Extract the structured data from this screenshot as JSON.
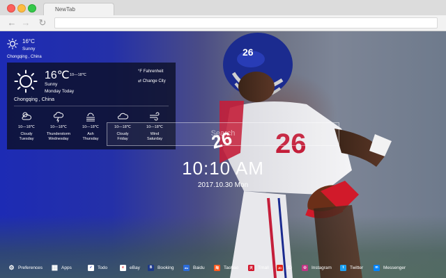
{
  "browser": {
    "tab_title": "NewTab",
    "nav": {
      "back": "←",
      "forward": "→",
      "reload": "↻"
    }
  },
  "weather_mini": {
    "temp": "16°C",
    "condition": "Sunny",
    "location": "Chongqing , China"
  },
  "weather_panel": {
    "temp": "16℃",
    "range": "10—18℃",
    "condition": "Sunny",
    "day": "Monday Today",
    "location": "Chongqing , China",
    "fahrenheit_label": "Fahrenheit",
    "fahrenheit_icon": "°F",
    "change_city_label": "Change City",
    "change_city_icon": "⇄",
    "forecast": [
      {
        "range": "10—18℃",
        "condition": "Cloudy",
        "day": "Tuesday",
        "icon": "cloud-sun-icon"
      },
      {
        "range": "10—18℃",
        "condition": "Thunderstorm",
        "day": "Wednesday",
        "icon": "thunderstorm-icon"
      },
      {
        "range": "10—18℃",
        "condition": "Ash",
        "day": "Thursday",
        "icon": "ash-icon"
      },
      {
        "range": "10—18℃",
        "condition": "Cloudy",
        "day": "Friday",
        "icon": "cloud-icon"
      },
      {
        "range": "10—18℃",
        "condition": "Wind",
        "day": "Saturday",
        "icon": "wind-icon"
      }
    ]
  },
  "search": {
    "placeholder": "Search"
  },
  "clock": {
    "time": "10:10 AM",
    "date": "2017.10.30 Mon"
  },
  "bottom_bar": {
    "items": [
      {
        "label": "Preferences",
        "icon": "gear-icon",
        "color": "#3a3f55",
        "glyph": "⚙"
      },
      {
        "label": "Apps",
        "icon": "apps-grid-icon",
        "color": "#3a3f55",
        "glyph": "▦"
      },
      {
        "label": "Todo",
        "icon": "todo-check-icon",
        "color": "#ffffff",
        "glyph": "✓"
      },
      {
        "label": "eBay",
        "icon": "ebay-icon",
        "color": "#ffffff",
        "glyph": "e"
      },
      {
        "label": "Booking",
        "icon": "booking-icon",
        "color": "#1e3a8a",
        "glyph": "B"
      },
      {
        "label": "Baidu",
        "icon": "baidu-icon",
        "color": "#2b6bd8",
        "glyph": "du"
      },
      {
        "label": "Taobao",
        "icon": "taobao-icon",
        "color": "#ff5a1f",
        "glyph": "淘"
      },
      {
        "label": "Tmall",
        "icon": "tmall-icon",
        "color": "#d2162c",
        "glyph": "天"
      },
      {
        "label": "JD",
        "icon": "jd-icon",
        "color": "#e1251b",
        "glyph": "JD"
      },
      {
        "label": "Instagram",
        "icon": "instagram-icon",
        "color": "#c13584",
        "glyph": "◎"
      },
      {
        "label": "Twitter",
        "icon": "twitter-icon",
        "color": "#1da1f2",
        "glyph": "t"
      },
      {
        "label": "Messenger",
        "icon": "messenger-icon",
        "color": "#0084ff",
        "glyph": "m"
      }
    ]
  },
  "colors": {
    "panel_bg": "#0c1028",
    "accent_blue": "#1d2bb4"
  }
}
